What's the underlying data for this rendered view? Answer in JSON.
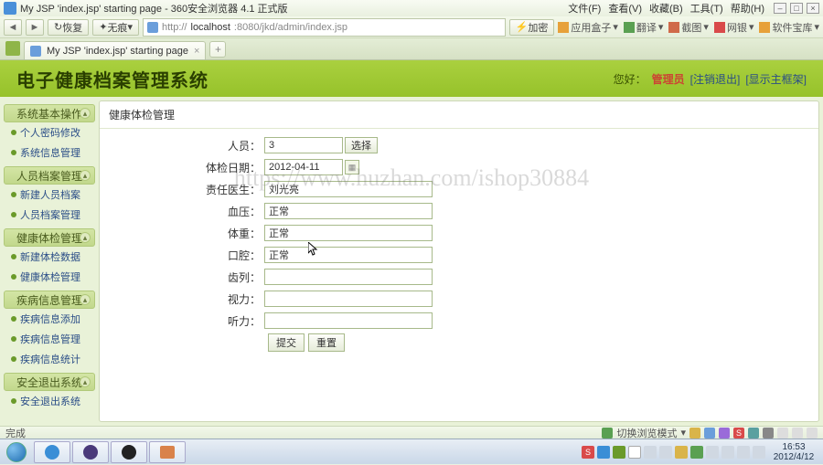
{
  "browser": {
    "window_title": "My JSP 'index.jsp' starting page - 360安全浏览器 4.1 正式版",
    "menus": [
      "文件(F)",
      "查看(V)",
      "收藏(B)",
      "工具(T)",
      "帮助(H)"
    ],
    "nav": {
      "back": "◄",
      "forward": "►",
      "refresh": "恢复",
      "none": "无痕"
    },
    "url_prefix": "http://",
    "url_host": "localhost",
    "url_rest": ":8080/jkd/admin/index.jsp",
    "jiami": "加密",
    "right_tools": [
      "应用盒子",
      "翻译",
      "截图",
      "网银",
      "软件宝库"
    ],
    "tab_label": "My JSP 'index.jsp' starting page"
  },
  "header": {
    "system_title": "电子健康档案管理系统",
    "greeting": "您好：",
    "username": "管理员",
    "logout": "[注销退出]",
    "frame": "[显示主框架]"
  },
  "sidebar": [
    {
      "title": "系统基本操作",
      "items": [
        "个人密码修改",
        "系统信息管理"
      ]
    },
    {
      "title": "人员档案管理",
      "items": [
        "新建人员档案",
        "人员档案管理"
      ]
    },
    {
      "title": "健康体检管理",
      "items": [
        "新建体检数据",
        "健康体检管理"
      ]
    },
    {
      "title": "疾病信息管理",
      "items": [
        "疾病信息添加",
        "疾病信息管理",
        "疾病信息统计"
      ]
    },
    {
      "title": "安全退出系统",
      "items": [
        "安全退出系统"
      ]
    }
  ],
  "panel": {
    "title": "健康体检管理",
    "fields": {
      "person_label": "人员：",
      "person_value": "3",
      "person_btn": "选择",
      "date_label": "体检日期：",
      "date_value": "2012-04-11",
      "doctor_label": "责任医生：",
      "doctor_value": "刘光亮",
      "bp_label": "血压：",
      "bp_value": "正常",
      "weight_label": "体重：",
      "weight_value": "正常",
      "oral_label": "口腔：",
      "oral_value": "正常",
      "gender_label": "齿列：",
      "gender_value": "",
      "vision_label": "视力：",
      "vision_value": "",
      "hearing_label": "听力：",
      "hearing_value": ""
    },
    "buttons": {
      "submit": "提交",
      "reset": "重置"
    }
  },
  "watermark": "https://www.huzhan.com/ishop30884",
  "status": {
    "left": "完成",
    "mode": "切换浏览模式"
  },
  "taskbar": {
    "time": "16:53",
    "date": "2012/4/12"
  }
}
